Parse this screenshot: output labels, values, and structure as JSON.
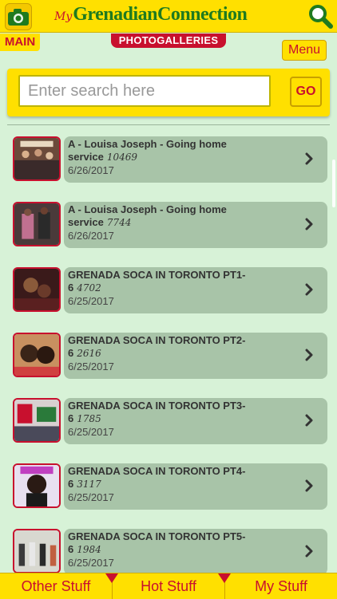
{
  "header": {
    "logo_prefix": "My",
    "logo_text": "GrenadianConnection",
    "camera_icon": "camera-icon",
    "search_icon": "magnifier-icon"
  },
  "tabs": {
    "main_label": "MAIN",
    "page_label": "PHOTOGALLERIES",
    "menu_label": "Menu"
  },
  "search": {
    "placeholder": "Enter search here",
    "go_label": "GO"
  },
  "galleries": [
    {
      "title": "A - Louisa Joseph - Going home service",
      "count": "10469",
      "date": "6/26/2017"
    },
    {
      "title": "A - Louisa Joseph - Going home service",
      "count": "7744",
      "date": "6/26/2017"
    },
    {
      "title": "GRENADA SOCA IN TORONTO PT1-6",
      "count": "4702",
      "date": "6/25/2017"
    },
    {
      "title": "GRENADA SOCA IN TORONTO PT2-6",
      "count": "2616",
      "date": "6/25/2017"
    },
    {
      "title": "GRENADA SOCA IN TORONTO PT3-6",
      "count": "1785",
      "date": "6/25/2017"
    },
    {
      "title": "GRENADA SOCA IN TORONTO PT4-6",
      "count": "3117",
      "date": "6/25/2017"
    },
    {
      "title": "GRENADA SOCA IN TORONTO PT5-6",
      "count": "1984",
      "date": "6/25/2017"
    }
  ],
  "bottom_nav": {
    "other": "Other Stuff",
    "hot": "Hot Stuff",
    "my": "My Stuff"
  },
  "colors": {
    "accent_yellow": "#ffe000",
    "accent_red": "#c8102e",
    "logo_green": "#1f7a1f",
    "background": "#d7f2d7",
    "card": "#a8c4a8"
  }
}
